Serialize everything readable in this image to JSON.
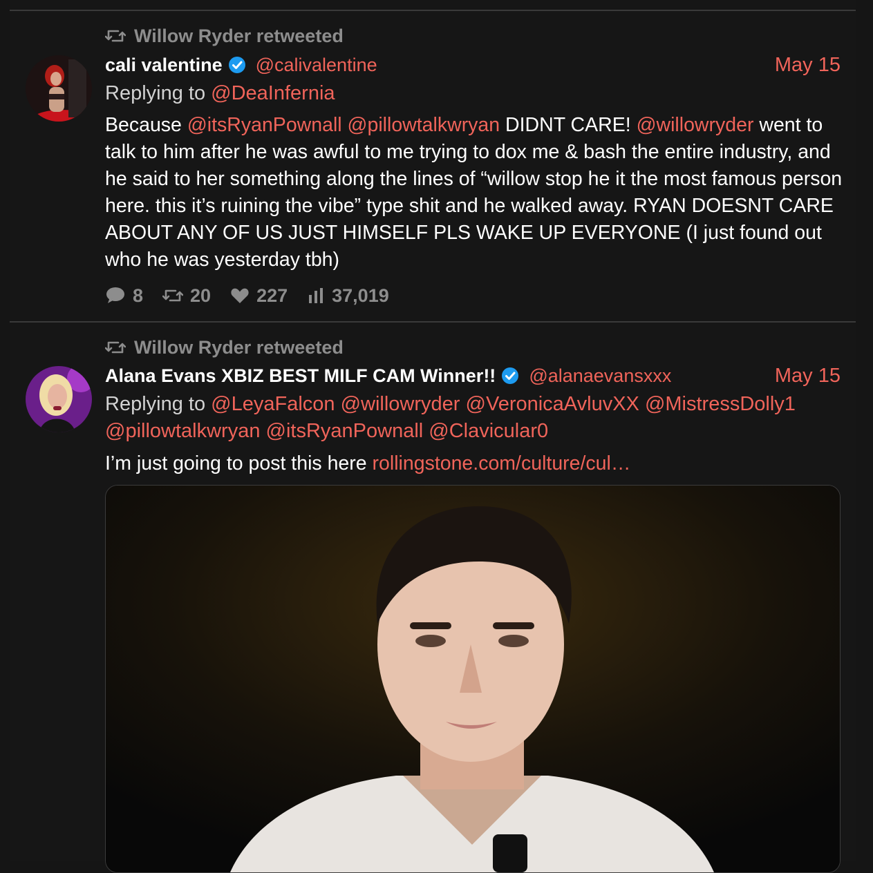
{
  "tweets": [
    {
      "retweeted_by": "Willow Ryder retweeted",
      "display_name": "cali valentine",
      "handle": "@calivalentine",
      "date": "May 15",
      "replying_prefix": "Replying to",
      "replying_to": [
        "@DeaInfernia"
      ],
      "body": [
        {
          "text": "Because ",
          "mention": false
        },
        {
          "text": "@itsRyanPownall",
          "mention": true
        },
        {
          "text": " ",
          "mention": false
        },
        {
          "text": "@pillowtalkwryan",
          "mention": true
        },
        {
          "text": " DIDNT CARE! ",
          "mention": false
        },
        {
          "text": "@willowryder",
          "mention": true
        },
        {
          "text": " went to talk to him after he was awful to me trying to dox me & bash the entire industry, and he said to her something along the lines of “willow stop he it the most famous person here. this it’s ruining the vibe” type shit and he walked away. RYAN DOESNT CARE ABOUT ANY OF US JUST HIMSELF PLS WAKE UP EVERYONE (I just found out who he was yesterday tbh)",
          "mention": false
        }
      ],
      "stats": {
        "replies": "8",
        "retweets": "20",
        "likes": "227",
        "views": "37,019"
      }
    },
    {
      "retweeted_by": "Willow Ryder retweeted",
      "display_name": "Alana Evans XBIZ BEST MILF CAM Winner!!",
      "handle": "@alanaevansxxx",
      "date": "May 15",
      "replying_prefix": "Replying to",
      "replying_to": [
        "@LeyaFalcon",
        "@willowryder",
        "@VeronicaAvluvXX",
        "@MistressDolly1",
        "@pillowtalkwryan",
        "@itsRyanPownall",
        "@Clavicular0"
      ],
      "body": [
        {
          "text": "I’m just going to post this here ",
          "mention": false
        },
        {
          "text": "rollingstone.com/culture/cul…",
          "mention": true
        }
      ]
    }
  ],
  "colors": {
    "background": "#161616",
    "accent": "#f0645a",
    "muted": "#8d8d8d",
    "verified": "#1d9bf0"
  }
}
